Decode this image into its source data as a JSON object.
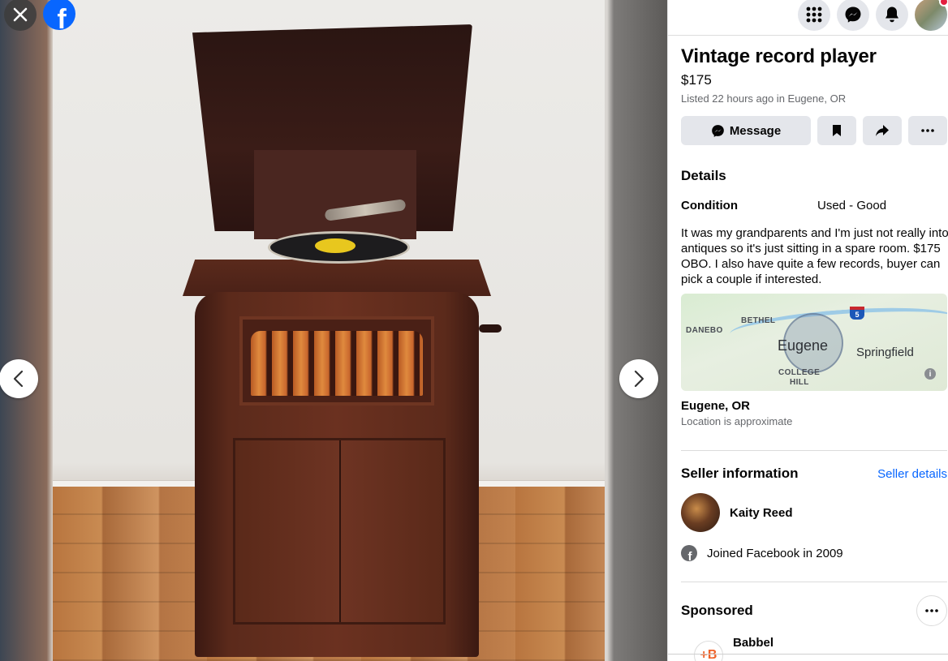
{
  "viewer": {
    "close_icon": "close-icon",
    "logo_icon": "facebook-logo-icon",
    "logo_letter": "f",
    "prev_icon": "chevron-left-icon",
    "next_icon": "chevron-right-icon"
  },
  "topbar": {
    "menu_icon": "grid-menu-icon",
    "messenger_icon": "messenger-icon",
    "notifications_icon": "bell-icon",
    "notification_dot_color": "#e41e3f"
  },
  "listing": {
    "title": "Vintage record player",
    "price": "$175",
    "listed": "Listed 22 hours ago in Eugene, OR",
    "message_label": "Message",
    "details_heading": "Details",
    "condition_label": "Condition",
    "condition_value": "Used - Good",
    "description": "It was my grandparents and I'm just not really into antiques so it's just sitting in a spare room. $175 OBO. I also have quite a few records, buyer can pick a couple if interested."
  },
  "map": {
    "labels": {
      "bethel": "BETHEL",
      "danebo": "DANEBO",
      "eugene": "Eugene",
      "springfield": "Springfield",
      "college": "COLLEGE",
      "hill": "HILL",
      "interstate": "5"
    },
    "info": "i"
  },
  "location": {
    "title": "Eugene, OR",
    "subtitle": "Location is approximate"
  },
  "seller": {
    "heading": "Seller information",
    "details_link": "Seller details",
    "name": "Kaity Reed",
    "joined": "Joined Facebook in 2009",
    "fb_letter": "f"
  },
  "sponsored": {
    "heading": "Sponsored",
    "ad_name": "Babbel",
    "ad_logo_text": "+B"
  },
  "colors": {
    "accent": "#0866ff",
    "button_bg": "#e4e6eb",
    "secondary_text": "#65676b"
  }
}
